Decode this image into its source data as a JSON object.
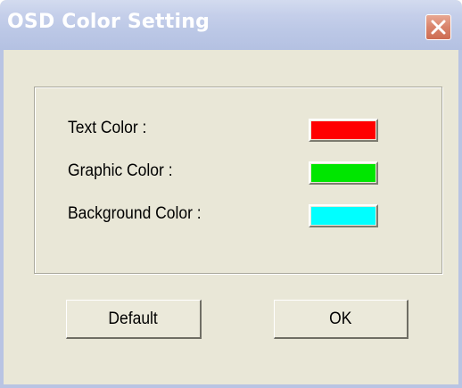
{
  "window": {
    "title": "OSD Color Setting"
  },
  "colors": {
    "titlebar": "#bcc8e6",
    "dialog_background": "#e9e7d7",
    "close_button": "#d9836b"
  },
  "settings": [
    {
      "label": "Text Color :",
      "color": "#ff0000"
    },
    {
      "label": "Graphic Color :",
      "color": "#00e600"
    },
    {
      "label": "Background Color :",
      "color": "#00ffff"
    }
  ],
  "buttons": {
    "default_label": "Default",
    "ok_label": "OK"
  },
  "icons": {
    "close": "close-icon"
  }
}
